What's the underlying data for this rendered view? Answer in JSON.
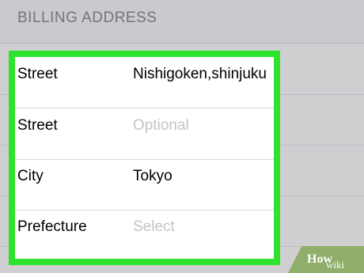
{
  "section": {
    "title": "BILLING ADDRESS"
  },
  "rows": [
    {
      "label": "Street",
      "value": "Nishigoken,shinjuku",
      "placeholder": false
    },
    {
      "label": "Street",
      "value": "Optional",
      "placeholder": true
    },
    {
      "label": "City",
      "value": "Tokyo",
      "placeholder": false
    },
    {
      "label": "Prefecture",
      "value": "Select",
      "placeholder": true
    }
  ],
  "background_rows": [
    {
      "label": "Street",
      "value": "Nishigoken,shinjuku"
    },
    {
      "label": "Street",
      "value": "Optional"
    },
    {
      "label": "City",
      "value": "Tokyo"
    },
    {
      "label": "Prefecture",
      "value": "Select"
    }
  ],
  "highlight_color": "#2de32d",
  "watermark": {
    "text_small": "wiki",
    "text_bold": "How"
  }
}
